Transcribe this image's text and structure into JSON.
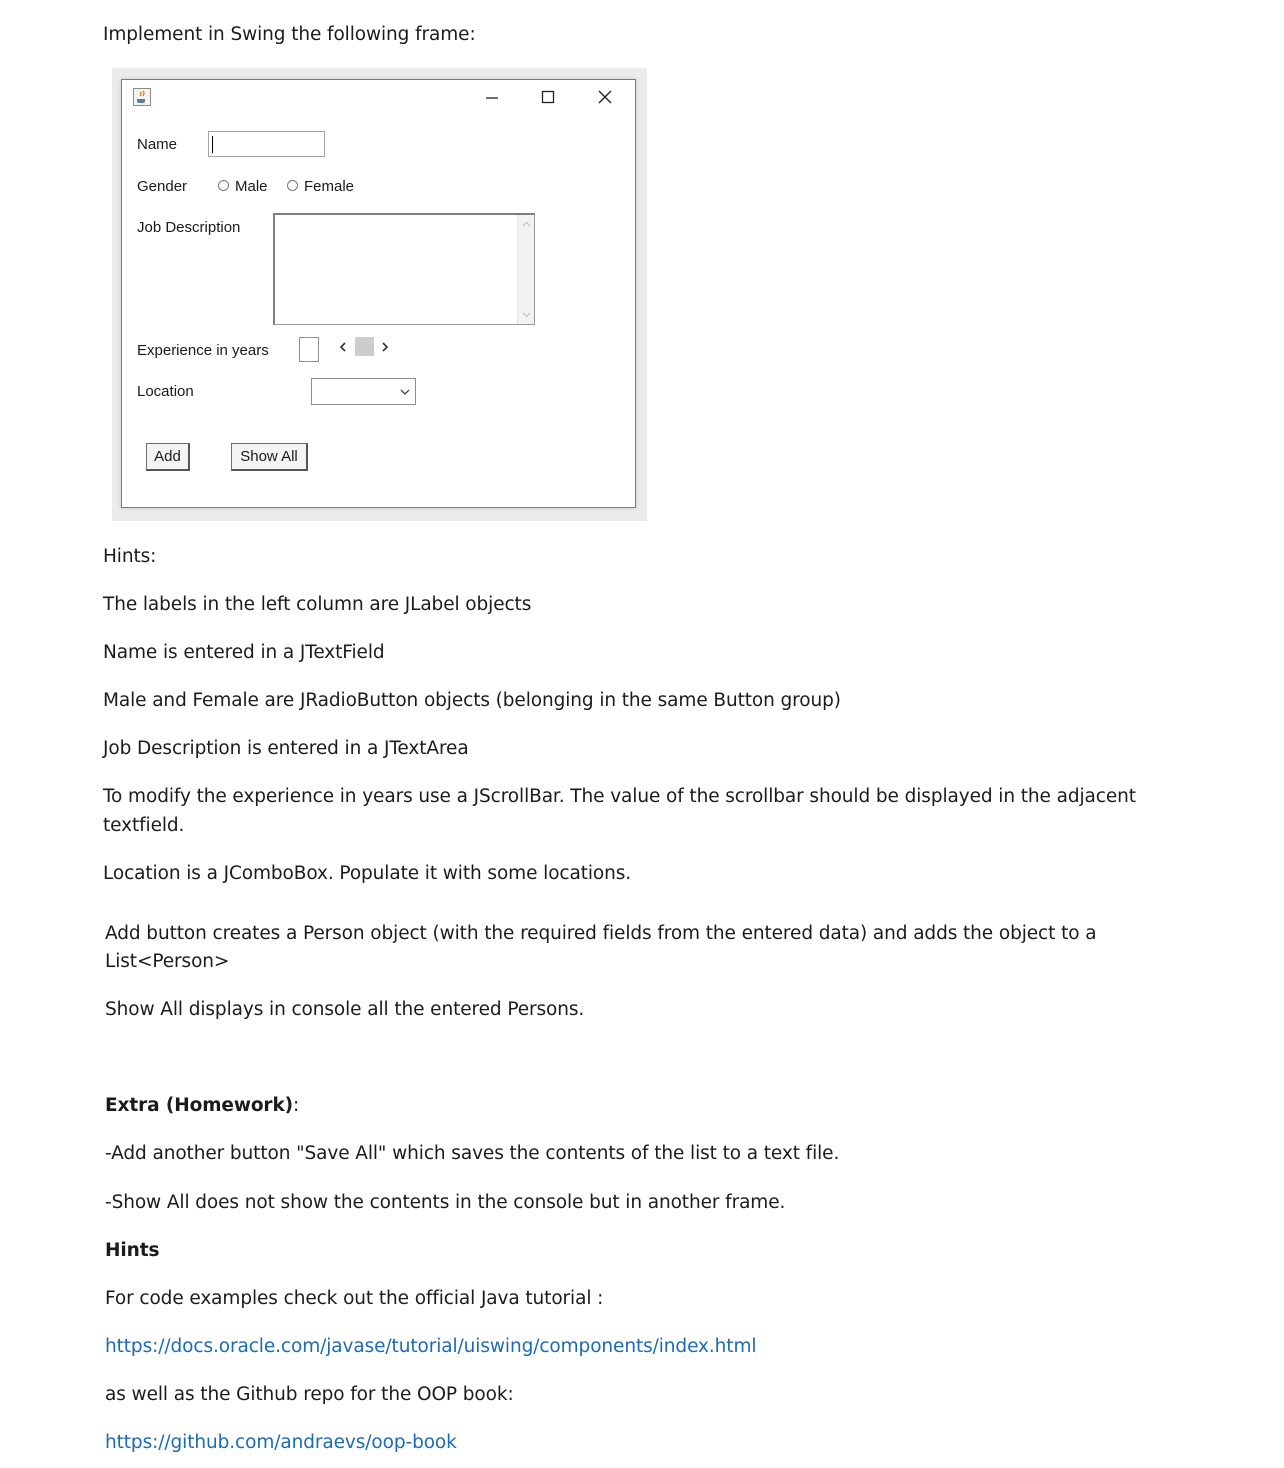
{
  "intro": "Implement in Swing the following frame:",
  "swing_frame": {
    "title_bar": {
      "icon": "java-cup-icon",
      "controls": [
        "minimize-icon",
        "maximize-icon",
        "close-icon"
      ]
    },
    "name_label": "Name",
    "name_value": "",
    "gender_label": "Gender",
    "gender_options": [
      "Male",
      "Female"
    ],
    "job_label": "Job Description",
    "job_value": "",
    "experience_label": "Experience in years",
    "experience_value": "",
    "location_label": "Location",
    "location_value": "",
    "add_button": "Add",
    "show_all_button": "Show All"
  },
  "hints_heading": "Hints:",
  "hints": [
    "The labels in the left column are JLabel objects",
    "Name is entered in a JTextField",
    "Male and Female are JRadioButton objects (belonging in the same Button group)",
    "Job Description is entered in a JTextArea",
    "To modify the experience in years use a JScrollBar. The value of the scrollbar should be displayed in the adjacent",
    "textfield.",
    "Location is a JComboBox. Populate it with some locations."
  ],
  "add_desc_line1": "Add button creates a Person object (with the required fields from the entered data) and adds the object to a",
  "add_desc_line2": "List<Person>",
  "show_all_desc": "Show All displays in console all the entered Persons.",
  "extra_heading": "Extra (Homework)",
  "extra_colon": ":",
  "extra_items": [
    "-Add another button \"Save All\" which saves the contents of the list to a text file.",
    "-Show All does not show the contents in the console but in another frame."
  ],
  "hints2_heading": "Hints",
  "code_examples_text": "For code examples check out the official Java tutorial :",
  "tutorial_link": "https://docs.oracle.com/javase/tutorial/uiswing/components/index.html",
  "github_text": "as well as the Github repo for the OOP book:",
  "github_link": "https://github.com/andraevs/oop-book",
  "colors": {
    "link": "#1c6ab5",
    "text": "#1b1b1b"
  }
}
